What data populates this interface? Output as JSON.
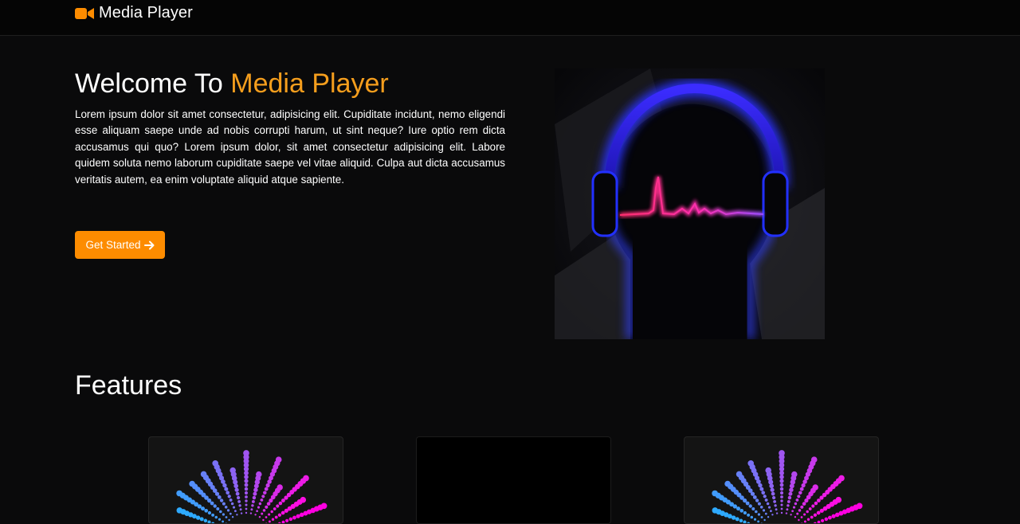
{
  "nav": {
    "brand_icon": "video-camera-icon",
    "brand_text": "Media Player"
  },
  "hero": {
    "title_prefix": "Welcome To ",
    "title_accent": "Media Player",
    "body": "Lorem ipsum dolor sit amet consectetur, adipisicing elit. Cupiditate incidunt, nemo eligendi esse aliquam saepe unde ad nobis corrupti harum, ut sint neque? Iure optio rem dicta accusamus qui quo? Lorem ipsum dolor, sit amet consectetur adipisicing elit. Labore quidem soluta nemo laborum cupiditate saepe vel vitae aliquid. Culpa aut dicta accusamus veritatis autem, ea enim voluptate aliquid atque sapiente.",
    "cta_label": "Get Started",
    "cta_icon": "arrow-right-icon",
    "image": "headphones-heartbeat-illustration"
  },
  "features": {
    "title": "Features",
    "cards": [
      {
        "image": "equalizer-burst-illustration"
      },
      {
        "image": "blank-video-thumbnail"
      },
      {
        "image": "equalizer-burst-illustration"
      }
    ]
  },
  "colors": {
    "accent": "#f59e1d",
    "button": "#fd8c00",
    "background": "#0a0a0b"
  }
}
